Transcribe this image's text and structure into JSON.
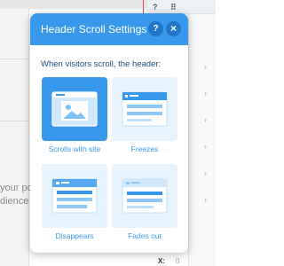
{
  "background": {
    "text_line_1": "your pos",
    "text_line_2": "dience t",
    "right_panel_help": "?",
    "right_panel_grip": "⠿",
    "coord_label": "X:",
    "coord_value": "0"
  },
  "dialog": {
    "title": "Header Scroll Settings",
    "help_label": "?",
    "close_label": "×",
    "prompt": "When visitors scroll, the header:",
    "options": [
      {
        "label": "Scrolls with site",
        "icon": "scrolls-with-site-icon",
        "selected": true
      },
      {
        "label": "Freezes",
        "icon": "freezes-icon",
        "selected": false
      },
      {
        "label": "Disappears",
        "icon": "disappears-icon",
        "selected": false
      },
      {
        "label": "Fades out",
        "icon": "fades-out-icon",
        "selected": false
      }
    ]
  },
  "colors": {
    "accent": "#3899ec",
    "accent_dark": "#2174c6",
    "option_bg": "#e7f4fd",
    "prompt_text": "#1c4f7c"
  }
}
